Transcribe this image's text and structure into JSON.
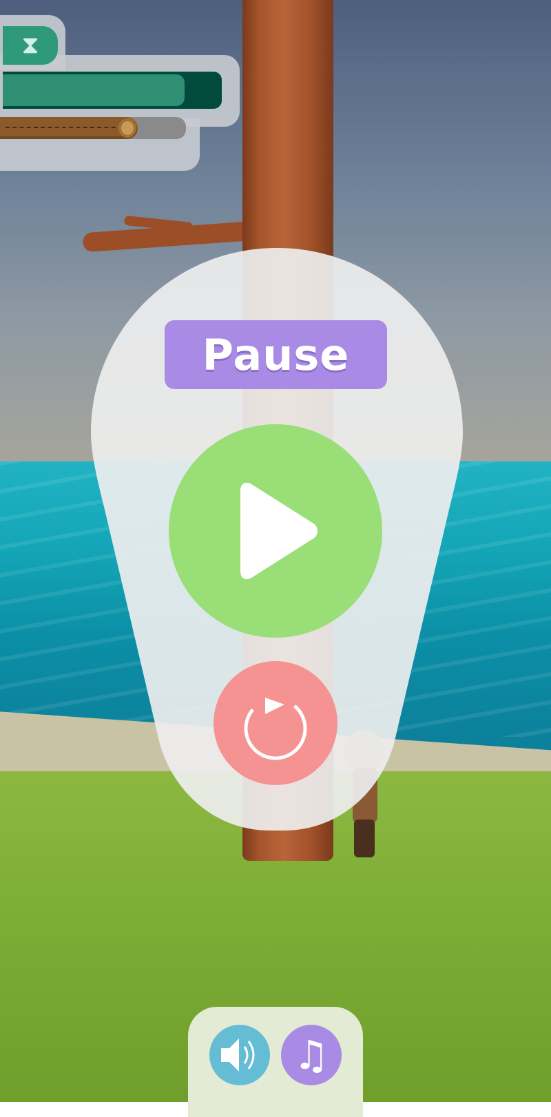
{
  "pause_menu": {
    "title": "Pause"
  },
  "hud": {
    "timer_icon": "hourglass-icon",
    "timer_glyph": "⧗",
    "time_remaining_fraction": 0.83,
    "log_progress_fraction": 0.74
  },
  "buttons": {
    "resume_icon": "play-icon",
    "restart_icon": "restart-icon",
    "sound_icon": "speaker-icon",
    "music_icon": "music-note-icon",
    "music_glyph": "♫"
  },
  "colors": {
    "title_badge": "#a98be6",
    "resume": "#9ade78",
    "restart": "#f59292",
    "sound": "#64bdd4",
    "music": "#a98be6",
    "timer_bar": "#2f8f72",
    "timer_bg": "#024b3c"
  }
}
